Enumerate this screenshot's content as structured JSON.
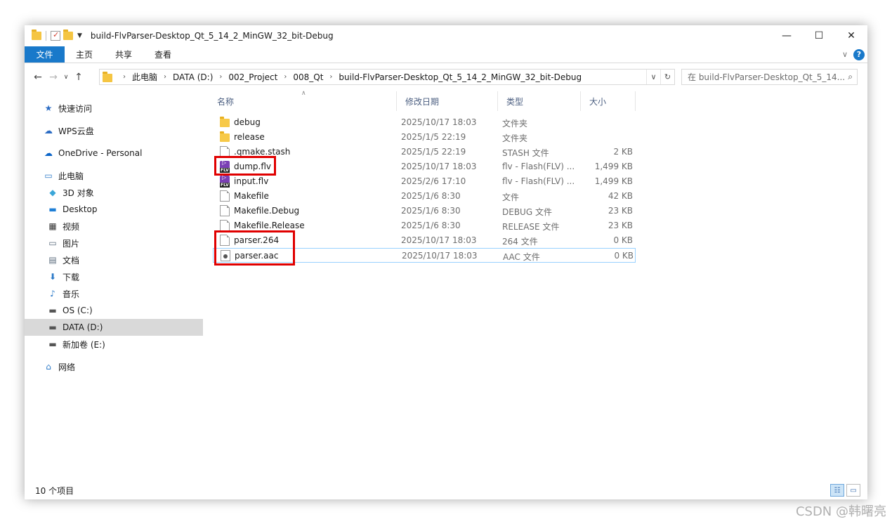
{
  "window": {
    "title": "build-FlvParser-Desktop_Qt_5_14_2_MinGW_32_bit-Debug"
  },
  "ribbon": {
    "tabs": [
      "文件",
      "主页",
      "共享",
      "查看"
    ],
    "help_label": "?"
  },
  "address": {
    "crumbs": [
      "此电脑",
      "DATA (D:)",
      "002_Project",
      "008_Qt",
      "build-FlvParser-Desktop_Qt_5_14_2_MinGW_32_bit-Debug"
    ],
    "search_placeholder": "在 build-FlvParser-Desktop_Qt_5_14..."
  },
  "nav": {
    "items": [
      {
        "label": "快速访问",
        "icon": "star-icon"
      },
      {
        "label": "WPS云盘",
        "icon": "cloud-icon"
      },
      {
        "label": "OneDrive - Personal",
        "icon": "onedrive-icon"
      },
      {
        "label": "此电脑",
        "icon": "computer-icon"
      },
      {
        "label": "3D 对象",
        "icon": "cube-icon"
      },
      {
        "label": "Desktop",
        "icon": "desktop-icon"
      },
      {
        "label": "视频",
        "icon": "video-icon"
      },
      {
        "label": "图片",
        "icon": "picture-icon"
      },
      {
        "label": "文档",
        "icon": "document-icon"
      },
      {
        "label": "下载",
        "icon": "download-icon"
      },
      {
        "label": "音乐",
        "icon": "music-icon"
      },
      {
        "label": "OS (C:)",
        "icon": "drive-icon"
      },
      {
        "label": "DATA (D:)",
        "icon": "drive-icon"
      },
      {
        "label": "新加卷 (E:)",
        "icon": "drive-icon"
      },
      {
        "label": "网络",
        "icon": "network-icon"
      }
    ]
  },
  "columns": {
    "name": "名称",
    "date": "修改日期",
    "type": "类型",
    "size": "大小"
  },
  "files": [
    {
      "name": "debug",
      "date": "2025/10/17 18:03",
      "type": "文件夹",
      "size": "",
      "icon": "folder-icon"
    },
    {
      "name": "release",
      "date": "2025/1/5 22:19",
      "type": "文件夹",
      "size": "",
      "icon": "folder-icon"
    },
    {
      "name": ".qmake.stash",
      "date": "2025/1/5 22:19",
      "type": "STASH 文件",
      "size": "2 KB",
      "icon": "file-icon"
    },
    {
      "name": "dump.flv",
      "date": "2025/10/17 18:03",
      "type": "flv - Flash(FLV) ...",
      "size": "1,499 KB",
      "icon": "flv-icon"
    },
    {
      "name": "input.flv",
      "date": "2025/2/6 17:10",
      "type": "flv - Flash(FLV) ...",
      "size": "1,499 KB",
      "icon": "flv-icon"
    },
    {
      "name": "Makefile",
      "date": "2025/1/6 8:30",
      "type": "文件",
      "size": "42 KB",
      "icon": "file-icon"
    },
    {
      "name": "Makefile.Debug",
      "date": "2025/1/6 8:30",
      "type": "DEBUG 文件",
      "size": "23 KB",
      "icon": "file-icon"
    },
    {
      "name": "Makefile.Release",
      "date": "2025/1/6 8:30",
      "type": "RELEASE 文件",
      "size": "23 KB",
      "icon": "file-icon"
    },
    {
      "name": "parser.264",
      "date": "2025/10/17 18:03",
      "type": "264 文件",
      "size": "0 KB",
      "icon": "file-icon"
    },
    {
      "name": "parser.aac",
      "date": "2025/10/17 18:03",
      "type": "AAC 文件",
      "size": "0 KB",
      "icon": "media-file-icon"
    }
  ],
  "status": {
    "count": "10 个项目"
  },
  "watermark": "CSDN @韩曙亮",
  "colors": {
    "accent": "#1979ca",
    "highlight_box": "#e00000",
    "selection": "#d9d9d9"
  }
}
